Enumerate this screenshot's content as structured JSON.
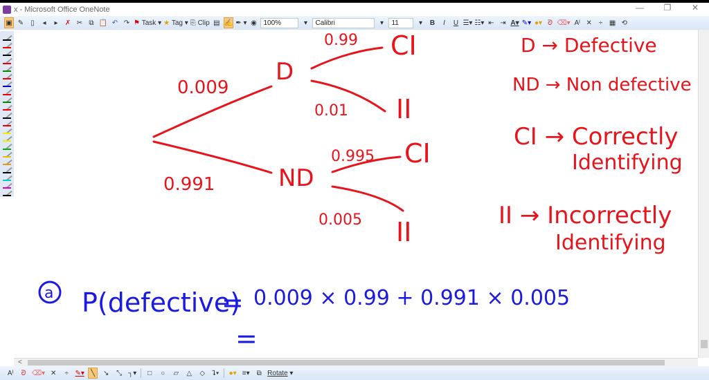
{
  "window": {
    "title": "x - Microsoft Office OneNote",
    "minimize": "—",
    "restore": "❐",
    "close": "✕"
  },
  "toolbar": {
    "task_label": "Task",
    "tag_label": "Tag",
    "clip_label": "Clip",
    "zoom": "100%",
    "font": "Calibri",
    "font_size": "11",
    "bold": "B",
    "italic": "I",
    "underline": "U"
  },
  "bottombar": {
    "rotate_label": "Rotate"
  },
  "hscroll": {
    "left_arrow": "<"
  },
  "colors": {
    "red_ink": "#e8141c",
    "blue_ink": "#1a1ae0",
    "toolbar_bg": "#dfe8f4"
  },
  "palette": [
    "#000",
    "#e00",
    "#000",
    "#e00",
    "#080",
    "#e00",
    "#00c",
    "#e00",
    "#080",
    "#e00",
    "#000",
    "#e00",
    "#ee0",
    "#ee0",
    "#0a0",
    "#e0c000",
    "#e0a000",
    "#000",
    "#0cc",
    "#c0c",
    "#000"
  ],
  "tree": {
    "p_d": "0.009",
    "p_nd": "0.991",
    "d": "D",
    "nd": "ND",
    "p_d_ci": "0.99",
    "p_d_ii": "0.01",
    "p_nd_ci": "0.995",
    "p_nd_ii": "0.005",
    "ci1": "CI",
    "ii1": "II",
    "ci2": "CI",
    "ii2": "II"
  },
  "legend": [
    "D → Defective",
    "ND → Non defective",
    "CI → Correctly",
    "Identifying",
    "II → Incorrectly",
    "Identifying"
  ],
  "solution": {
    "label": "a",
    "lhs": "P(defective)",
    "eq": "=",
    "rhs": "0.009 × 0.99 + 0.991 × 0.005",
    "eq2": "="
  }
}
